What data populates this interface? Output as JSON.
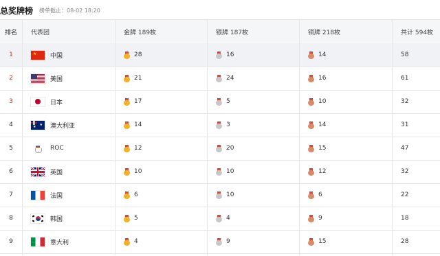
{
  "header": {
    "title": "总奖牌榜",
    "updated": "榜单截止：08-02 18:20"
  },
  "columns": {
    "rank": "排名",
    "team": "代表团",
    "gold": "金牌 189枚",
    "silver": "银牌 187枚",
    "bronze": "铜牌 218枚",
    "total": "共计 594枚"
  },
  "rows": [
    {
      "rank": "1",
      "name": "中国",
      "flag": "china-flag-icon",
      "gold": "28",
      "silver": "16",
      "bronze": "14",
      "total": "58"
    },
    {
      "rank": "2",
      "name": "美国",
      "flag": "usa-flag-icon",
      "gold": "21",
      "silver": "24",
      "bronze": "16",
      "total": "61"
    },
    {
      "rank": "3",
      "name": "日本",
      "flag": "japan-flag-icon",
      "gold": "17",
      "silver": "5",
      "bronze": "10",
      "total": "32"
    },
    {
      "rank": "4",
      "name": "澳大利亚",
      "flag": "australia-flag-icon",
      "gold": "14",
      "silver": "3",
      "bronze": "14",
      "total": "31"
    },
    {
      "rank": "5",
      "name": "ROC",
      "flag": "roc-logo-icon",
      "gold": "12",
      "silver": "20",
      "bronze": "15",
      "total": "47"
    },
    {
      "rank": "6",
      "name": "英国",
      "flag": "uk-flag-icon",
      "gold": "10",
      "silver": "10",
      "bronze": "12",
      "total": "32"
    },
    {
      "rank": "7",
      "name": "法国",
      "flag": "france-flag-icon",
      "gold": "6",
      "silver": "10",
      "bronze": "6",
      "total": "22"
    },
    {
      "rank": "8",
      "name": "韩国",
      "flag": "korea-flag-icon",
      "gold": "5",
      "silver": "4",
      "bronze": "9",
      "total": "18"
    },
    {
      "rank": "9",
      "name": "意大利",
      "flag": "italy-flag-icon",
      "gold": "4",
      "silver": "9",
      "bronze": "15",
      "total": "28"
    }
  ],
  "colors": {
    "top_rank": "#d9291c",
    "gold": "#f0b22a",
    "silver": "#c8c8c8",
    "bronze": "#d68b6a"
  }
}
